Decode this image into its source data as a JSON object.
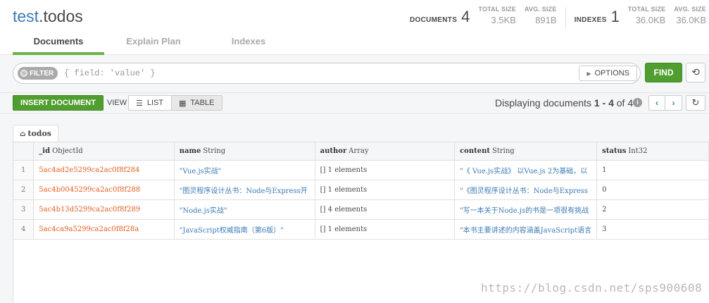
{
  "header": {
    "db_name": "test",
    "collection_name": ".todos",
    "documents_label": "DOCUMENTS",
    "documents_count": "4",
    "doc_total_size_label": "TOTAL SIZE",
    "doc_total_size": "3.5KB",
    "doc_avg_size_label": "AVG. SIZE",
    "doc_avg_size": "891B",
    "indexes_label": "INDEXES",
    "indexes_count": "1",
    "idx_total_size_label": "TOTAL SIZE",
    "idx_total_size": "36.0KB",
    "idx_avg_size_label": "AVG. SIZE",
    "idx_avg_size": "36.0KB"
  },
  "tabs": [
    {
      "label": "Documents",
      "active": true
    },
    {
      "label": "Explain Plan",
      "active": false
    },
    {
      "label": "Indexes",
      "active": false
    }
  ],
  "query": {
    "filter_label": "FILTER",
    "filter_text": "{ field: 'value' }",
    "options_label": "OPTIONS",
    "find_label": "FIND"
  },
  "controls": {
    "insert_label": "INSERT DOCUMENT",
    "view_label": "VIEW",
    "list_label": "LIST",
    "table_label": "TABLE",
    "display_prefix": "Displaying documents ",
    "display_range": "1 - 4",
    "display_of": " of ",
    "display_total": "4"
  },
  "collection_tab": "todos",
  "table": {
    "columns": [
      {
        "name": "_id",
        "type": "ObjectId"
      },
      {
        "name": "name",
        "type": "String"
      },
      {
        "name": "author",
        "type": "Array"
      },
      {
        "name": "content",
        "type": "String"
      },
      {
        "name": "status",
        "type": "Int32"
      }
    ],
    "rows": [
      {
        "idx": "1",
        "id": "5ac4ad2e5299ca2ac0f8f284",
        "name": "\"Vue.js实战\"",
        "author": "[] 1 elements",
        "content": "\"《 Vue.js实战》 以Vue.js 2为基础，以",
        "status": "1"
      },
      {
        "idx": "2",
        "id": "5ac4b0045299ca2ac0f8f288",
        "name": "\"图灵程序设计丛书：Node与Express开",
        "author": "[] 1 elements",
        "content": "\"《图灵程序设计丛书：Node与Express",
        "status": "0"
      },
      {
        "idx": "3",
        "id": "5ac4b13d5299ca2ac0f8f289",
        "name": "\"Node.js实战\"",
        "author": "[] 4 elements",
        "content": "\"写一本关于Node.js的书是一项很有挑战",
        "status": "2"
      },
      {
        "idx": "4",
        "id": "5ac4ca9a5299ca2ac0f8f28a",
        "name": "\"JavaScript权威指南（第6版）\"",
        "author": "[] 1 elements",
        "content": "\"本书主要讲述的内容涵盖JavaScript语言",
        "status": "3"
      }
    ]
  },
  "watermark": "https://blog.csdn.net/sps900608"
}
